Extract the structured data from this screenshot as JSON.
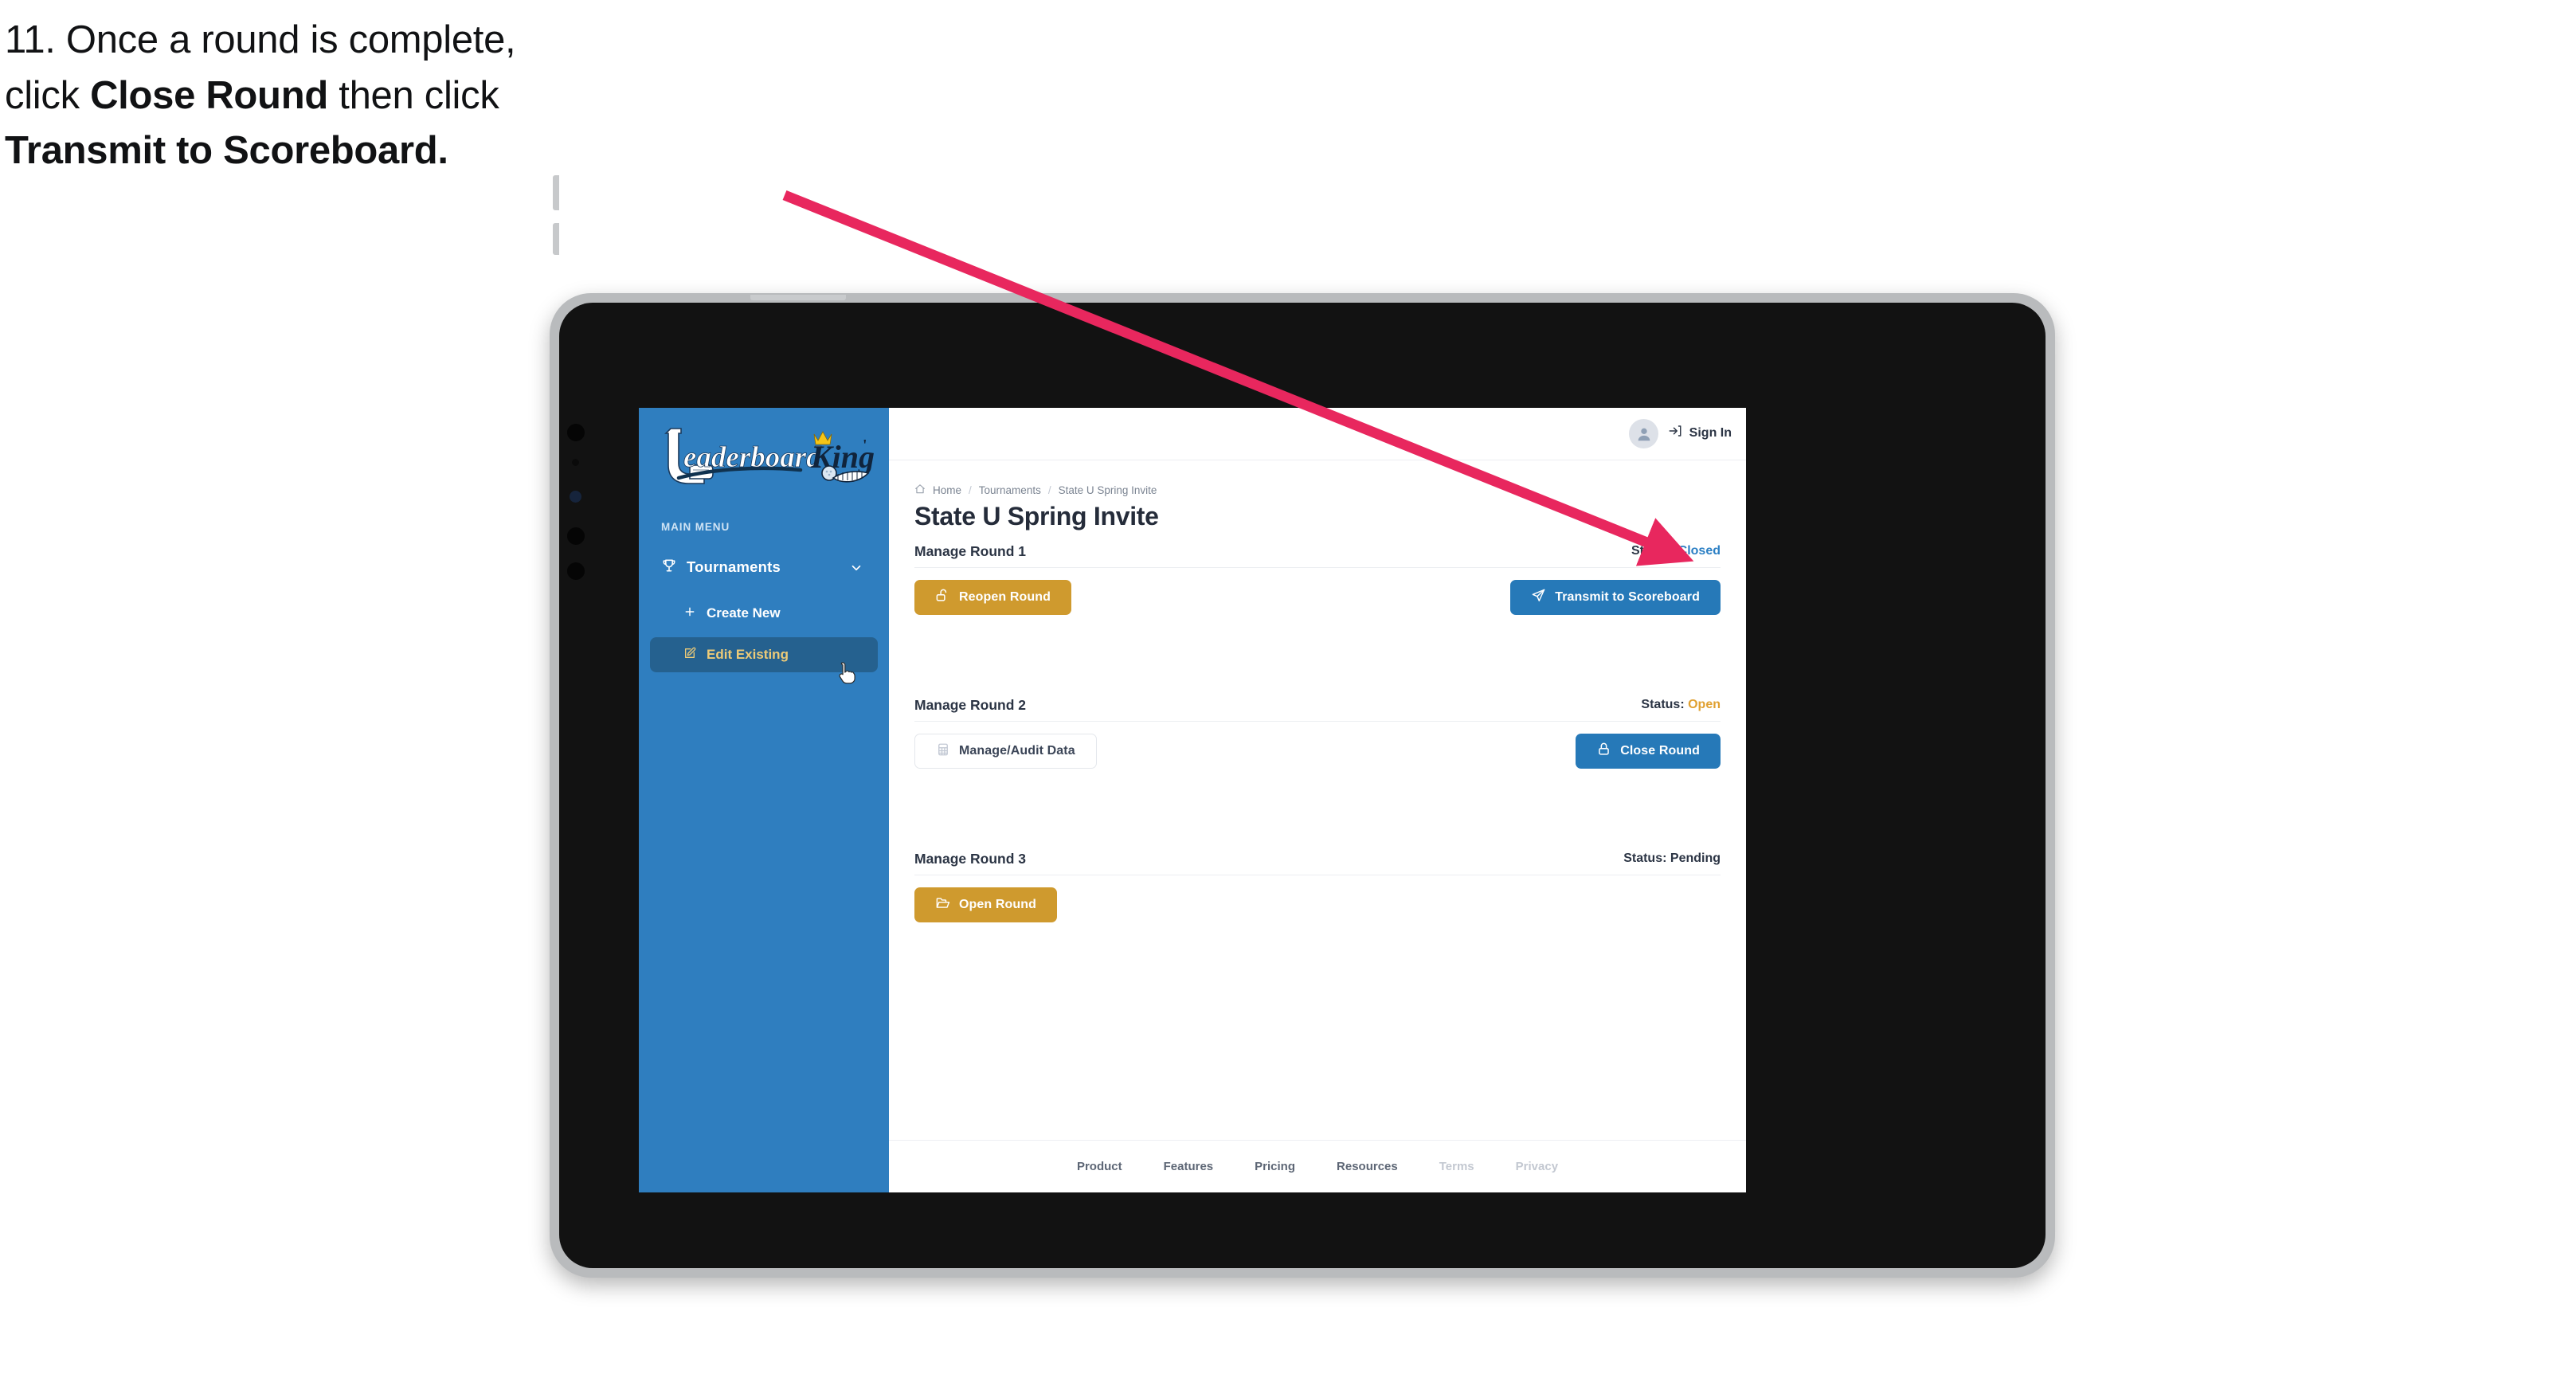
{
  "caption": {
    "line1_pre": "11. Once a round is complete,",
    "line2_pre": "click ",
    "line2_bold": "Close Round",
    "line2_post": " then click",
    "line3_bold": "Transmit to Scoreboard."
  },
  "annotation": {
    "type": "arrow",
    "color": "#e8275e",
    "points_to": "transmit-to-scoreboard-button"
  },
  "device": {
    "type": "tablet",
    "frame_color": "#b9bbbd",
    "bezel_color": "#121212"
  },
  "app": {
    "brand": {
      "name_part1": "Leaderboard",
      "name_part2": "King",
      "icon": "golf-club-logo"
    },
    "sidebar": {
      "bg": "#2f7ebf",
      "section_label": "MAIN MENU",
      "items": [
        {
          "label": "Tournaments",
          "icon": "trophy-icon",
          "expanded": true,
          "chevron": "chevron-down-icon"
        },
        {
          "label": "Create New",
          "icon": "plus-icon",
          "active": false
        },
        {
          "label": "Edit Existing",
          "icon": "edit-square-icon",
          "active": true,
          "active_text_color": "#edcb78",
          "active_bg": "#25618f"
        }
      ]
    },
    "topbar": {
      "avatar_icon": "user-avatar-icon",
      "signin_icon": "login-arrow-icon",
      "signin_label": "Sign In"
    },
    "breadcrumb": {
      "home_icon": "home-icon",
      "items": [
        "Home",
        "Tournaments",
        "State U Spring Invite"
      ],
      "separator": "/"
    },
    "page_title": "State U Spring Invite",
    "rounds": [
      {
        "name": "Manage Round 1",
        "status_label": "Status:",
        "status_value": "Closed",
        "status_color": "#2b7fc4",
        "left_button": {
          "label": "Reopen Round",
          "icon": "unlock-icon",
          "style": "gold"
        },
        "right_button": {
          "label": "Transmit to Scoreboard",
          "icon": "paper-plane-icon",
          "style": "blue"
        }
      },
      {
        "name": "Manage Round 2",
        "status_label": "Status:",
        "status_value": "Open",
        "status_color": "#e0a030",
        "left_button": {
          "label": "Manage/Audit Data",
          "icon": "table-grid-icon",
          "style": "ghost"
        },
        "right_button": {
          "label": "Close Round",
          "icon": "lock-icon",
          "style": "blue"
        }
      },
      {
        "name": "Manage Round 3",
        "status_label": "Status:",
        "status_value": "Pending",
        "status_color": "#2b3444",
        "left_button": {
          "label": "Open Round",
          "icon": "folder-open-icon",
          "style": "gold"
        },
        "right_button": null
      }
    ],
    "footer": {
      "links": [
        {
          "label": "Product",
          "dim": false
        },
        {
          "label": "Features",
          "dim": false
        },
        {
          "label": "Pricing",
          "dim": false
        },
        {
          "label": "Resources",
          "dim": false
        },
        {
          "label": "Terms",
          "dim": true
        },
        {
          "label": "Privacy",
          "dim": true
        }
      ]
    },
    "cursor": {
      "type": "pointing-hand",
      "over": "Edit Existing"
    }
  }
}
